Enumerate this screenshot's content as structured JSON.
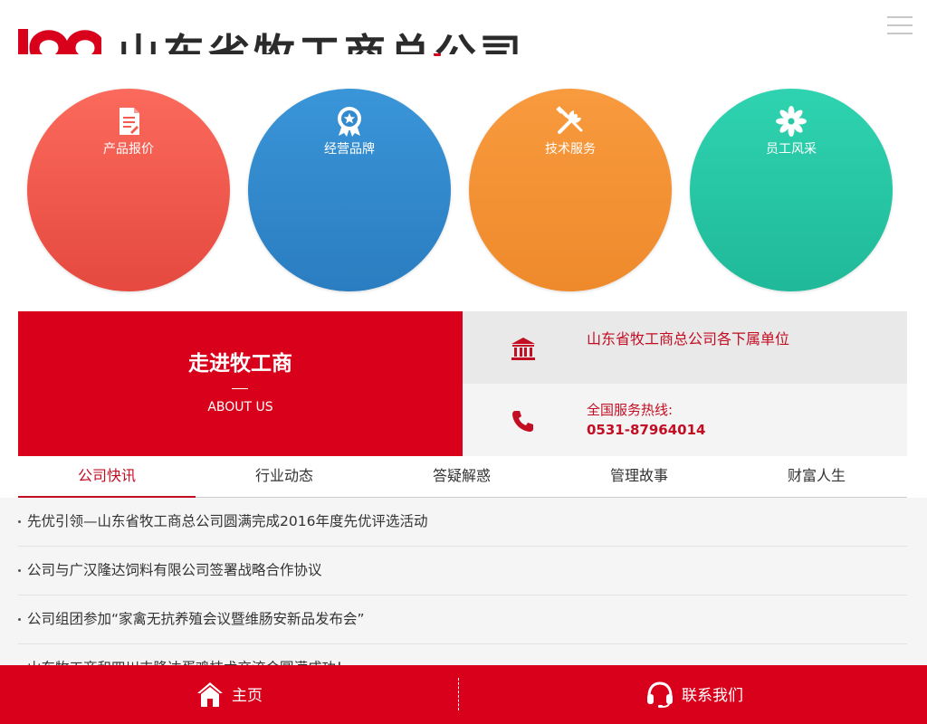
{
  "header": {
    "logo_text": "山东省牧工商总公司",
    "menu_icon": "hamburger-menu-icon"
  },
  "quick_links": [
    {
      "label": "产品报价",
      "icon": "document-icon",
      "color": "#f25c4f"
    },
    {
      "label": "经营品牌",
      "icon": "award-badge-icon",
      "color": "#3189ce"
    },
    {
      "label": "技术服务",
      "icon": "tools-icon",
      "color": "#f39236"
    },
    {
      "label": "员工风采",
      "icon": "flower-icon",
      "color": "#27c6a4"
    }
  ],
  "about": {
    "title": "走进牧工商",
    "subtitle": "ABOUT US"
  },
  "info": {
    "units": "山东省牧工商总公司各下属单位",
    "hotline_label": "全国服务热线:",
    "hotline_number": "0531-87964014"
  },
  "tabs": [
    "公司快讯",
    "行业动态",
    "答疑解惑",
    "管理故事",
    "财富人生"
  ],
  "active_tab": "公司快讯",
  "news": [
    "先优引领—山东省牧工商总公司圆满完成2016年度先优评选活动",
    "公司与广汉隆达饲料有限公司签署战略合作协议",
    "公司组团参加“家禽无抗养殖会议暨维肠安新品发布会”",
    "山东牧工商和四川丰隆达蛋鸡技术交流会圆满成功！"
  ],
  "bottom_bar": {
    "home_label": "主页",
    "contact_label": "联系我们"
  },
  "colors": {
    "brand_red": "#d9001b",
    "text_red": "#c30d23"
  }
}
